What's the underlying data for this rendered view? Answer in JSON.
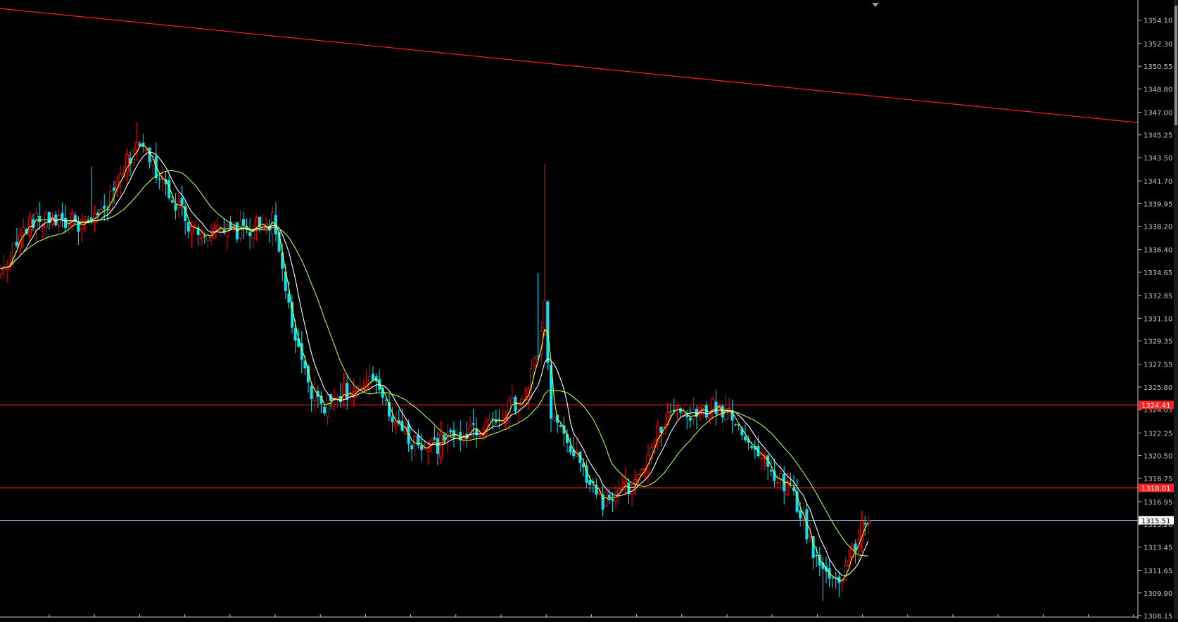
{
  "chart_data": {
    "type": "candlestick",
    "price_scale": {
      "min": 1308.15,
      "max": 1354.9,
      "tick_labels": [
        "1354.10",
        "1352.30",
        "1350.55",
        "1348.80",
        "1347.00",
        "1345.25",
        "1343.50",
        "1341.70",
        "1339.95",
        "1338.20",
        "1336.40",
        "1334.65",
        "1332.85",
        "1331.10",
        "1329.35",
        "1327.55",
        "1325.80",
        "1324.05",
        "1322.25",
        "1320.50",
        "1318.75",
        "1316.95",
        "1315.20",
        "1313.45",
        "1311.65",
        "1309.90",
        "1308.15"
      ]
    },
    "current_price": {
      "value": 1315.51,
      "label": "1315.51"
    },
    "horizontal_levels": [
      {
        "value": 1324.41,
        "label": "1324.41",
        "color": "#ff2020"
      },
      {
        "value": 1318.01,
        "label": "1318.01",
        "color": "#ff2020"
      }
    ],
    "trend_line": {
      "start_price": 1355.0,
      "end_price": 1346.2,
      "color": "#ff2020"
    },
    "colors": {
      "background": "#000000",
      "bull": "#ff0000",
      "bear": "#00e5ff",
      "ma_fast": "#ffff00",
      "ma_mid": "#ffffff",
      "ma_slow": "#aaff55",
      "axis": "#c8c8c8",
      "current_line": "#9ec9e6"
    },
    "ma_periods": [
      3,
      8,
      20
    ],
    "anchors": [
      [
        0,
        1334.6
      ],
      [
        8,
        1338.2
      ],
      [
        14,
        1338.9
      ],
      [
        20,
        1338.6
      ],
      [
        28,
        1338.2
      ],
      [
        34,
        1340.2
      ],
      [
        42,
        1344.8
      ],
      [
        50,
        1341.8
      ],
      [
        58,
        1338.4
      ],
      [
        66,
        1337.6
      ],
      [
        75,
        1337.9
      ],
      [
        84,
        1338.6
      ],
      [
        92,
        1328.2
      ],
      [
        96,
        1325.3
      ],
      [
        100,
        1324.4
      ],
      [
        106,
        1325.5
      ],
      [
        110,
        1325.1
      ],
      [
        116,
        1326.4
      ],
      [
        122,
        1323.0
      ],
      [
        126,
        1321.7
      ],
      [
        134,
        1321.2
      ],
      [
        140,
        1322.0
      ],
      [
        148,
        1322.6
      ],
      [
        156,
        1324.0
      ],
      [
        162,
        1324.9
      ],
      [
        166,
        1328.5
      ],
      [
        168,
        1332.0
      ],
      [
        170,
        1323.7
      ],
      [
        176,
        1321.0
      ],
      [
        182,
        1318.5
      ],
      [
        186,
        1317.0
      ],
      [
        190,
        1317.4
      ],
      [
        196,
        1318.3
      ],
      [
        200,
        1320.0
      ],
      [
        204,
        1322.8
      ],
      [
        208,
        1324.0
      ],
      [
        214,
        1323.5
      ],
      [
        220,
        1324.2
      ],
      [
        226,
        1323.8
      ],
      [
        232,
        1321.2
      ],
      [
        238,
        1319.3
      ],
      [
        244,
        1318.0
      ],
      [
        248,
        1315.5
      ],
      [
        252,
        1312.4
      ],
      [
        256,
        1311.1
      ],
      [
        260,
        1311.3
      ],
      [
        263,
        1312.8
      ],
      [
        266,
        1315.0
      ],
      [
        268,
        1315.5
      ]
    ]
  }
}
